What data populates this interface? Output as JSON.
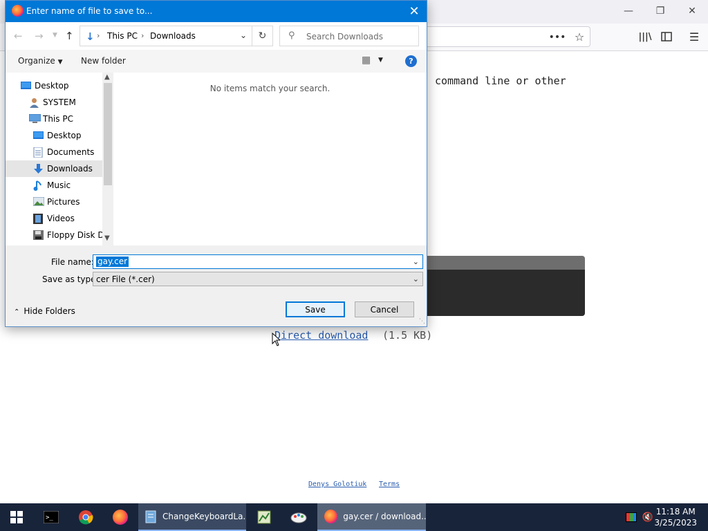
{
  "browser": {
    "page_text_line": "command line or other",
    "direct_download_label": "Direct download",
    "direct_download_size": "(1.5 KB)",
    "footer_author": "Denys Golotiuk",
    "footer_terms": "Terms",
    "icons": {
      "minimize": "minimize-icon",
      "restore": "restore-icon",
      "close": "close-icon",
      "menu_dots": "more-options-icon",
      "bookmark_star": "star-icon",
      "library": "library-icon",
      "sidebar": "sidebar-icon",
      "hamburger": "hamburger-menu-icon"
    }
  },
  "dialog": {
    "title": "Enter name of file to save to...",
    "breadcrumb": [
      "This PC",
      "Downloads"
    ],
    "search_placeholder": "Search Downloads",
    "organize_label": "Organize",
    "new_folder_label": "New folder",
    "empty_message": "No items match your search.",
    "nav_items": [
      {
        "label": "Desktop",
        "icon": "desktop-icon",
        "level": 0,
        "selected": false
      },
      {
        "label": "SYSTEM",
        "icon": "user-icon",
        "level": 1,
        "selected": false
      },
      {
        "label": "This PC",
        "icon": "computer-icon",
        "level": 1,
        "selected": false
      },
      {
        "label": "Desktop",
        "icon": "desktop-icon",
        "level": 2,
        "selected": false
      },
      {
        "label": "Documents",
        "icon": "documents-icon",
        "level": 2,
        "selected": false
      },
      {
        "label": "Downloads",
        "icon": "downloads-icon",
        "level": 2,
        "selected": true
      },
      {
        "label": "Music",
        "icon": "music-icon",
        "level": 2,
        "selected": false
      },
      {
        "label": "Pictures",
        "icon": "pictures-icon",
        "level": 2,
        "selected": false
      },
      {
        "label": "Videos",
        "icon": "videos-icon",
        "level": 2,
        "selected": false
      },
      {
        "label": "Floppy Disk Dri",
        "icon": "floppy-icon",
        "level": 2,
        "selected": false
      }
    ],
    "file_name_label": "File name:",
    "file_name_value": "gay.cer",
    "save_type_label": "Save as type:",
    "save_type_value": "cer File (*.cer)",
    "hide_folders_label": "Hide Folders",
    "save_button": "Save",
    "cancel_button": "Cancel",
    "accent_color": "#0078d7"
  },
  "taskbar": {
    "tasks": [
      {
        "label": "ChangeKeyboardLa...",
        "icon": "notepad-icon"
      },
      {
        "label": "gay.cer / download...",
        "icon": "firefox-icon"
      }
    ],
    "pinned_icons": [
      "windows-start-icon",
      "terminal-icon",
      "chrome-icon",
      "firefox-icon",
      "notepad-icon",
      "chart-icon",
      "paint-icon"
    ],
    "tray_icons": [
      "color-icon",
      "mute-icon"
    ],
    "time": "11:18 AM",
    "date": "3/25/2023"
  }
}
